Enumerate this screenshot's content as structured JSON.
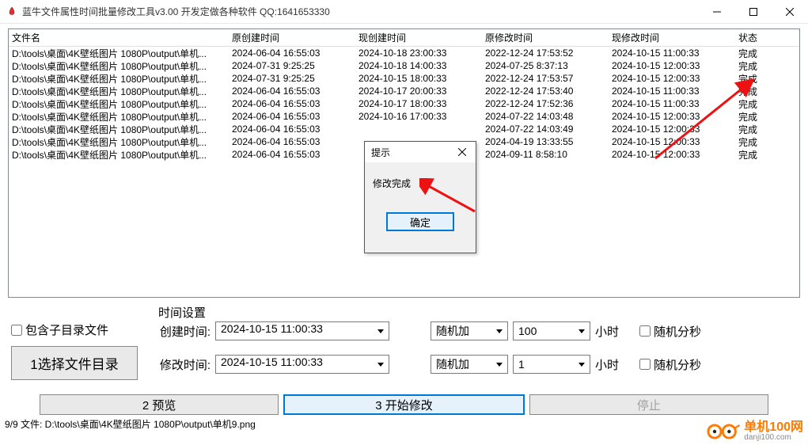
{
  "window": {
    "title": "蓝牛文件属性时间批量修改工具v3.00  开发定做各种软件  QQ:1641653330"
  },
  "columns": [
    "文件名",
    "原创建时间",
    "现创建时间",
    "原修改时间",
    "现修改时间",
    "状态"
  ],
  "rows": [
    {
      "file": "D:\\tools\\桌面\\4K壁纸图片 1080P\\output\\单机...",
      "oc": "2024-06-04 16:55:03",
      "nc": "2024-10-18 23:00:33",
      "om": "2022-12-24 17:53:52",
      "nm": "2024-10-15 11:00:33",
      "st": "完成"
    },
    {
      "file": "D:\\tools\\桌面\\4K壁纸图片 1080P\\output\\单机...",
      "oc": "2024-07-31 9:25:25",
      "nc": "2024-10-18 14:00:33",
      "om": "2024-07-25 8:37:13",
      "nm": "2024-10-15 12:00:33",
      "st": "完成"
    },
    {
      "file": "D:\\tools\\桌面\\4K壁纸图片 1080P\\output\\单机...",
      "oc": "2024-07-31 9:25:25",
      "nc": "2024-10-15 18:00:33",
      "om": "2022-12-24 17:53:57",
      "nm": "2024-10-15 12:00:33",
      "st": "完成"
    },
    {
      "file": "D:\\tools\\桌面\\4K壁纸图片 1080P\\output\\单机...",
      "oc": "2024-06-04 16:55:03",
      "nc": "2024-10-17 20:00:33",
      "om": "2022-12-24 17:53:40",
      "nm": "2024-10-15 11:00:33",
      "st": "完成"
    },
    {
      "file": "D:\\tools\\桌面\\4K壁纸图片 1080P\\output\\单机...",
      "oc": "2024-06-04 16:55:03",
      "nc": "2024-10-17 18:00:33",
      "om": "2022-12-24 17:52:36",
      "nm": "2024-10-15 11:00:33",
      "st": "完成"
    },
    {
      "file": "D:\\tools\\桌面\\4K壁纸图片 1080P\\output\\单机...",
      "oc": "2024-06-04 16:55:03",
      "nc": "2024-10-16 17:00:33",
      "om": "2024-07-22 14:03:48",
      "nm": "2024-10-15 12:00:33",
      "st": "完成"
    },
    {
      "file": "D:\\tools\\桌面\\4K壁纸图片 1080P\\output\\单机...",
      "oc": "2024-06-04 16:55:03",
      "nc": "",
      "om": "2024-07-22 14:03:49",
      "nm": "2024-10-15 12:00:33",
      "st": "完成"
    },
    {
      "file": "D:\\tools\\桌面\\4K壁纸图片 1080P\\output\\单机...",
      "oc": "2024-06-04 16:55:03",
      "nc": "",
      "om": "2024-04-19 13:33:55",
      "nm": "2024-10-15 12:00:33",
      "st": "完成"
    },
    {
      "file": "D:\\tools\\桌面\\4K壁纸图片 1080P\\output\\单机...",
      "oc": "2024-06-04 16:55:03",
      "nc": "",
      "om": "2024-09-11 8:58:10",
      "nm": "2024-10-15 12:00:33",
      "st": "完成"
    }
  ],
  "settings": {
    "group_label": "时间设置",
    "include_sub": "包含子目录文件",
    "select_dir": "1选择文件目录",
    "create_label": "创建时间:",
    "modify_label": "修改时间:",
    "create_val": "2024-10-15 11:00:33",
    "modify_val": "2024-10-15 11:00:33",
    "randmode1": "随机加",
    "randmode2": "随机加",
    "randnum1": "100",
    "randnum2": "1",
    "unit": "小时",
    "randsec": "随机分秒"
  },
  "buttons": {
    "preview": "2 预览",
    "start": "3 开始修改",
    "stop": "停止"
  },
  "statusbar": "9/9 文件:  D:\\tools\\桌面\\4K壁纸图片 1080P\\output\\单机9.png",
  "dialog": {
    "title": "提示",
    "body": "修改完成",
    "ok": "确定"
  },
  "brand": {
    "name": "单机100网",
    "url": "danji100.com"
  }
}
